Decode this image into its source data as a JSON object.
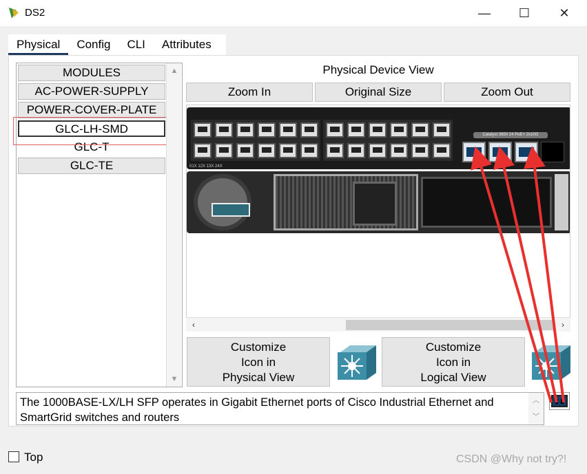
{
  "window": {
    "title": "DS2",
    "minimize": "—",
    "maximize": "☐",
    "close": "✕"
  },
  "tabs": [
    {
      "label": "Physical",
      "active": true
    },
    {
      "label": "Config"
    },
    {
      "label": "CLI"
    },
    {
      "label": "Attributes"
    }
  ],
  "modules": [
    {
      "label": "MODULES"
    },
    {
      "label": "AC-POWER-SUPPLY"
    },
    {
      "label": "POWER-COVER-PLATE"
    },
    {
      "label": "GLC-LH-SMD",
      "selected": true
    },
    {
      "label": "GLC-T"
    },
    {
      "label": "GLC-TE"
    }
  ],
  "device_view": {
    "title": "Physical Device View",
    "zoom_in": "Zoom In",
    "original_size": "Original Size",
    "zoom_out": "Zoom Out",
    "model_label": "Catalyst 3650 24 PoE+ 2x10G",
    "port_labels": "01X 12X 13X 24X"
  },
  "customize": {
    "physical": [
      "Customize",
      "Icon in",
      "Physical View"
    ],
    "logical": [
      "Customize",
      "Icon in",
      "Logical View"
    ]
  },
  "description": "The 1000BASE-LX/LH SFP operates in Gigabit Ethernet ports of Cisco Industrial Ethernet and SmartGrid switches and routers",
  "top_checkbox": {
    "label": "Top",
    "checked": false
  },
  "watermark": "CSDN @Why not try?!",
  "colors": {
    "accent": "#1e3a5f",
    "arrow": "#e8312f",
    "sfp": "#123d66"
  }
}
